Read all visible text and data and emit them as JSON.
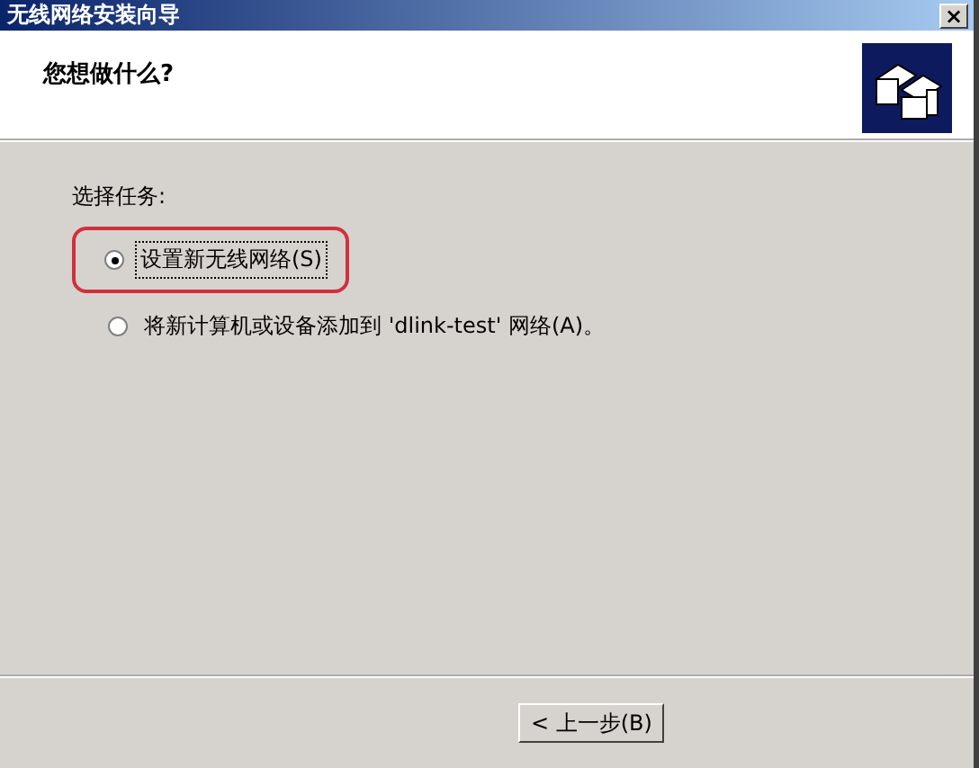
{
  "window": {
    "title": "无线网络安装向导",
    "close": "×"
  },
  "header": {
    "heading": "您想做什么?"
  },
  "task_group": {
    "label": "选择任务:",
    "options": [
      {
        "label": "设置新无线网络(S)",
        "selected": true,
        "focused": true,
        "highlighted": true
      },
      {
        "label": "将新计算机或设备添加到 'dlink-test' 网络(A)。",
        "selected": false,
        "focused": false,
        "highlighted": false
      }
    ]
  },
  "buttons": [
    {
      "label": "< 上一步(B)"
    }
  ]
}
